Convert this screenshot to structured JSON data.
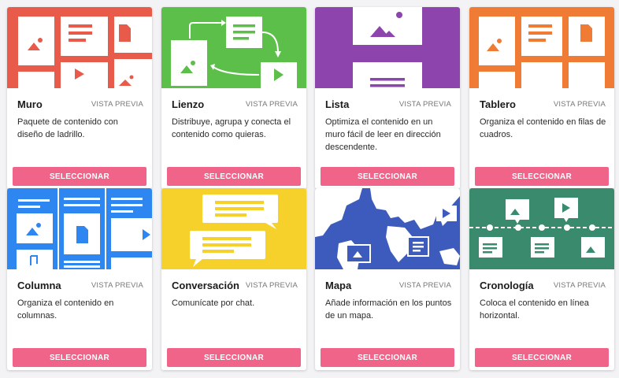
{
  "preview_label": "VISTA PREVIA",
  "select_label": "SELECCIONAR",
  "colors": {
    "button": "#f0648a",
    "muro": "#e85b4a",
    "lienzo": "#5bbf4a",
    "lista": "#8e44ad",
    "tablero": "#ef7b35",
    "columna": "#2e86f0",
    "conversacion": "#f6d12c",
    "mapa": "#3c5bbd",
    "cronologia": "#3a8b6e"
  },
  "cards": [
    {
      "title": "Muro",
      "description": "Paquete de contenido con diseño de ladrillo."
    },
    {
      "title": "Lienzo",
      "description": "Distribuye, agrupa y conecta el contenido como quieras."
    },
    {
      "title": "Lista",
      "description": "Optimiza el contenido en un muro fácil de leer en dirección descendente."
    },
    {
      "title": "Tablero",
      "description": "Organiza el contenido en filas de cuadros."
    },
    {
      "title": "Columna",
      "description": "Organiza el contenido en columnas."
    },
    {
      "title": "Conversación",
      "description": "Comunícate por chat."
    },
    {
      "title": "Mapa",
      "description": "Añade información en los puntos de un mapa."
    },
    {
      "title": "Cronología",
      "description": "Coloca el contenido en línea horizontal."
    }
  ]
}
